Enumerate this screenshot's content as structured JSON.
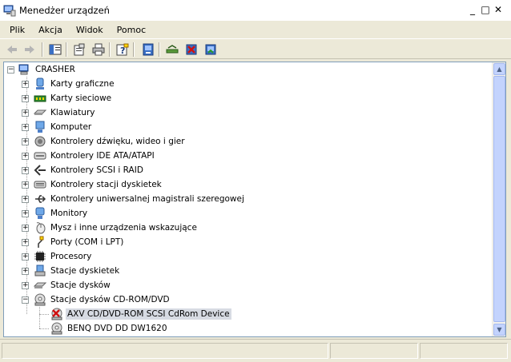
{
  "window": {
    "title": "Menedżer urządzeń",
    "controls": {
      "minimize": "_",
      "maximize": "□",
      "close": "✕"
    }
  },
  "menu": [
    "Plik",
    "Akcja",
    "Widok",
    "Pomoc"
  ],
  "toolbar": {
    "buttons": [
      "back-icon",
      "forward-icon",
      "show-hide-tree-icon",
      "properties-icon",
      "print-icon",
      "help-icon",
      "device-view-icon",
      "update-driver-icon",
      "uninstall-icon",
      "scan-hardware-icon"
    ]
  },
  "tree": {
    "root": "CRASHER",
    "categories": [
      "Karty graficzne",
      "Karty sieciowe",
      "Klawiatury",
      "Komputer",
      "Kontrolery dźwięku, wideo i gier",
      "Kontrolery IDE ATA/ATAPI",
      "Kontrolery SCSI i RAID",
      "Kontrolery stacji dyskietek",
      "Kontrolery uniwersalnej magistrali szeregowej",
      "Monitory",
      "Mysz i inne urządzenia wskazujące",
      "Porty (COM i LPT)",
      "Procesory",
      "Stacje dyskietek",
      "Stacje dysków",
      "Stacje dysków CD-ROM/DVD"
    ],
    "expanded_children": [
      "AXV CD/DVD-ROM SCSI CdRom Device",
      "BENQ DVD DD DW1620"
    ],
    "selected_child": "AXV CD/DVD-ROM SCSI CdRom Device"
  },
  "colors": {
    "selection": "#d7dbe3",
    "window_bg": "#ece9d8",
    "scroll_accent": "#c3d3fd"
  }
}
